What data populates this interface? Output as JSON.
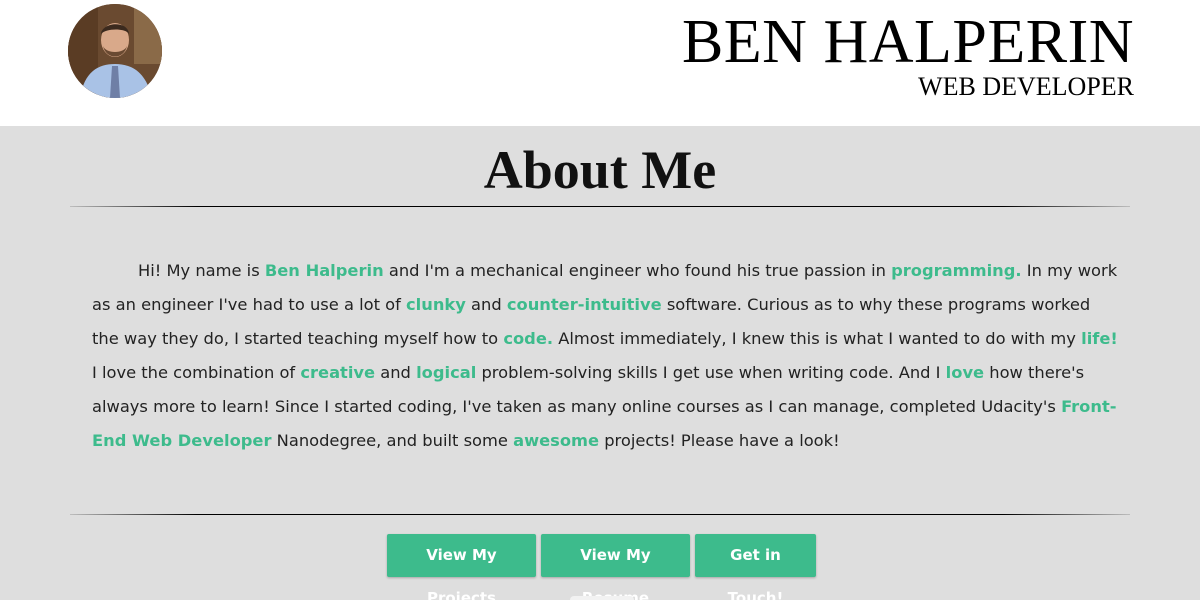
{
  "header": {
    "name": "BEN HALPERIN",
    "subtitle": "WEB DEVELOPER",
    "avatar_icon": "profile-photo"
  },
  "about": {
    "title": "About Me",
    "segments": [
      {
        "text": "Hi! My name is ",
        "highlight": false
      },
      {
        "text": "Ben Halperin",
        "highlight": true
      },
      {
        "text": " and I'm a mechanical engineer who found his true passion in ",
        "highlight": false
      },
      {
        "text": "programming.",
        "highlight": true
      },
      {
        "text": " In my work as an engineer I've had to use a lot of ",
        "highlight": false
      },
      {
        "text": "clunky",
        "highlight": true
      },
      {
        "text": " and ",
        "highlight": false
      },
      {
        "text": "counter-intuitive",
        "highlight": true
      },
      {
        "text": " software. Curious as to why these programs worked the way they do, I started teaching myself how to ",
        "highlight": false
      },
      {
        "text": "code.",
        "highlight": true
      },
      {
        "text": " Almost immediately, I knew this is what I wanted to do with my ",
        "highlight": false
      },
      {
        "text": "life!",
        "highlight": true
      },
      {
        "text": " I love the combination of ",
        "highlight": false
      },
      {
        "text": "creative",
        "highlight": true
      },
      {
        "text": " and ",
        "highlight": false
      },
      {
        "text": "logical",
        "highlight": true
      },
      {
        "text": " problem-solving skills I get use when writing code. And I ",
        "highlight": false
      },
      {
        "text": "love",
        "highlight": true
      },
      {
        "text": " how there's always more to learn! Since I started coding, I've taken as many online courses as I can manage, completed Udacity's ",
        "highlight": false
      },
      {
        "text": "Front-End Web Developer",
        "highlight": true
      },
      {
        "text": " Nanodegree, and built some ",
        "highlight": false
      },
      {
        "text": "awesome",
        "highlight": true
      },
      {
        "text": " projects! Please have a look!",
        "highlight": false
      }
    ]
  },
  "buttons": {
    "projects": "View My Projects",
    "resume": "View My Resume",
    "contact": "Get in Touch!"
  },
  "colors": {
    "accent": "#3dbb8c",
    "section_bg": "#dedede",
    "header_bg": "#ffffff"
  }
}
